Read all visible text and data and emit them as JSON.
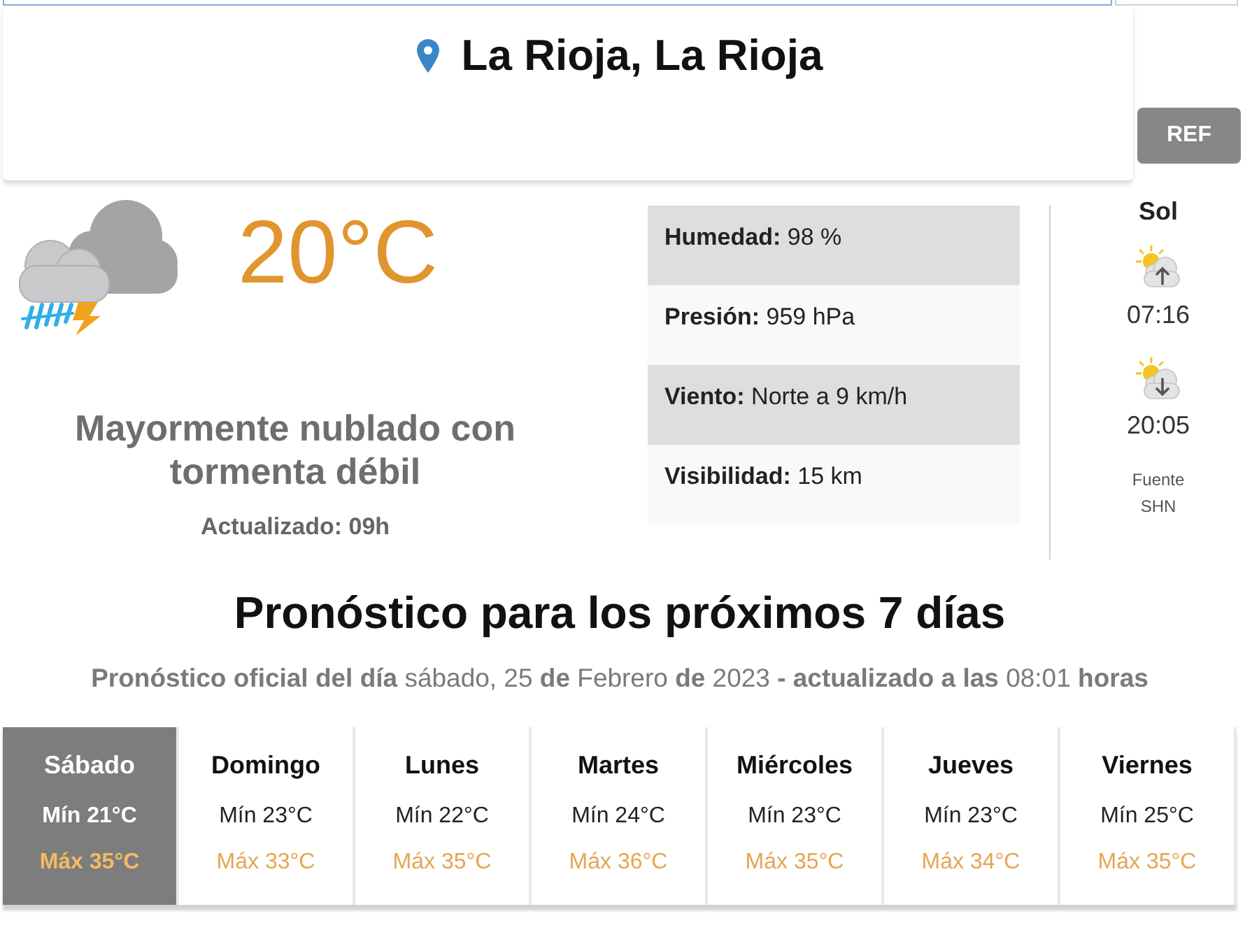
{
  "header": {
    "location": "La Rioja, La Rioja",
    "refresh_button": "REF"
  },
  "current": {
    "temperature": "20°C",
    "condition": "Mayormente nublado con tormenta débil",
    "updated": "Actualizado: 09h"
  },
  "details": [
    {
      "label": "Humedad:",
      "value": "98 %"
    },
    {
      "label": "Presión:",
      "value": "959 hPa"
    },
    {
      "label": "Viento:",
      "value": "Norte a 9 km/h"
    },
    {
      "label": "Visibilidad:",
      "value": "15 km"
    }
  ],
  "sun": {
    "title": "Sol",
    "sunrise": "07:16",
    "sunset": "20:05",
    "source_label": "Fuente",
    "source_name": "SHN"
  },
  "forecast": {
    "title": "Pronóstico para los próximos 7 días",
    "subtitle": "**Pronóstico oficial del día** sábado, 25 **de** Febrero **de** 2023 **- actualizado a las** 08:01 **horas**",
    "days": [
      {
        "name": "Sábado",
        "min": "Mín 21°C",
        "max": "Máx 35°C",
        "selected": true
      },
      {
        "name": "Domingo",
        "min": "Mín 23°C",
        "max": "Máx 33°C",
        "selected": false
      },
      {
        "name": "Lunes",
        "min": "Mín 22°C",
        "max": "Máx 35°C",
        "selected": false
      },
      {
        "name": "Martes",
        "min": "Mín 24°C",
        "max": "Máx 36°C",
        "selected": false
      },
      {
        "name": "Miércoles",
        "min": "Mín 23°C",
        "max": "Máx 35°C",
        "selected": false
      },
      {
        "name": "Jueves",
        "min": "Mín 23°C",
        "max": "Máx 34°C",
        "selected": false
      },
      {
        "name": "Viernes",
        "min": "Mín 25°C",
        "max": "Máx 35°C",
        "selected": false
      }
    ]
  }
}
